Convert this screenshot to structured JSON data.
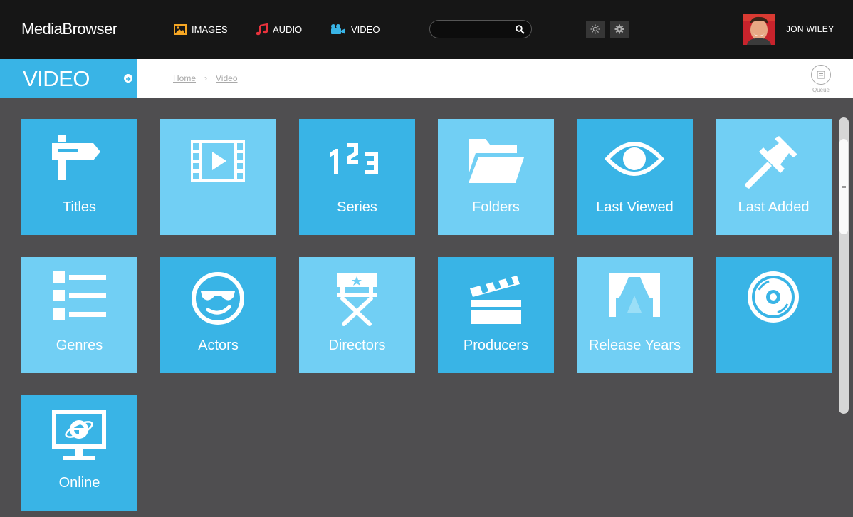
{
  "app": {
    "name": "MediaBrowser"
  },
  "nav": [
    {
      "label": "IMAGES",
      "icon": "image-icon",
      "color": "#f5a623"
    },
    {
      "label": "AUDIO",
      "icon": "music-note-icon",
      "color": "#e8323c"
    },
    {
      "label": "VIDEO",
      "icon": "video-camera-icon",
      "color": "#39b4e6"
    }
  ],
  "search": {
    "value": "",
    "placeholder": ""
  },
  "toolbar": {
    "brightness_icon": "brightness-icon",
    "settings_icon": "gear-icon"
  },
  "user": {
    "name": "JON WILEY"
  },
  "section": {
    "title": "VIDEO"
  },
  "breadcrumb": {
    "home": "Home",
    "separator": "›",
    "current": "Video"
  },
  "queue": {
    "label": "Queue"
  },
  "tiles": [
    {
      "label": "Titles",
      "icon": "signpost-icon",
      "shade": "dark"
    },
    {
      "label": "",
      "icon": "film-strip-icon",
      "shade": "light"
    },
    {
      "label": "Series",
      "icon": "numbers-123-icon",
      "shade": "dark"
    },
    {
      "label": "Folders",
      "icon": "folder-icon",
      "shade": "light"
    },
    {
      "label": "Last Viewed",
      "icon": "eye-icon",
      "shade": "dark"
    },
    {
      "label": "Last Added",
      "icon": "pushpin-icon",
      "shade": "light"
    },
    {
      "label": "Genres",
      "icon": "list-icon",
      "shade": "light"
    },
    {
      "label": "Actors",
      "icon": "smiley-sunglasses-icon",
      "shade": "dark"
    },
    {
      "label": "Directors",
      "icon": "directors-chair-icon",
      "shade": "light"
    },
    {
      "label": "Producers",
      "icon": "clapperboard-icon",
      "shade": "dark"
    },
    {
      "label": "Release Years",
      "icon": "theater-curtain-icon",
      "shade": "light"
    },
    {
      "label": "",
      "icon": "disc-icon",
      "shade": "dark"
    },
    {
      "label": "Online",
      "icon": "internet-monitor-icon",
      "shade": "dark"
    }
  ]
}
